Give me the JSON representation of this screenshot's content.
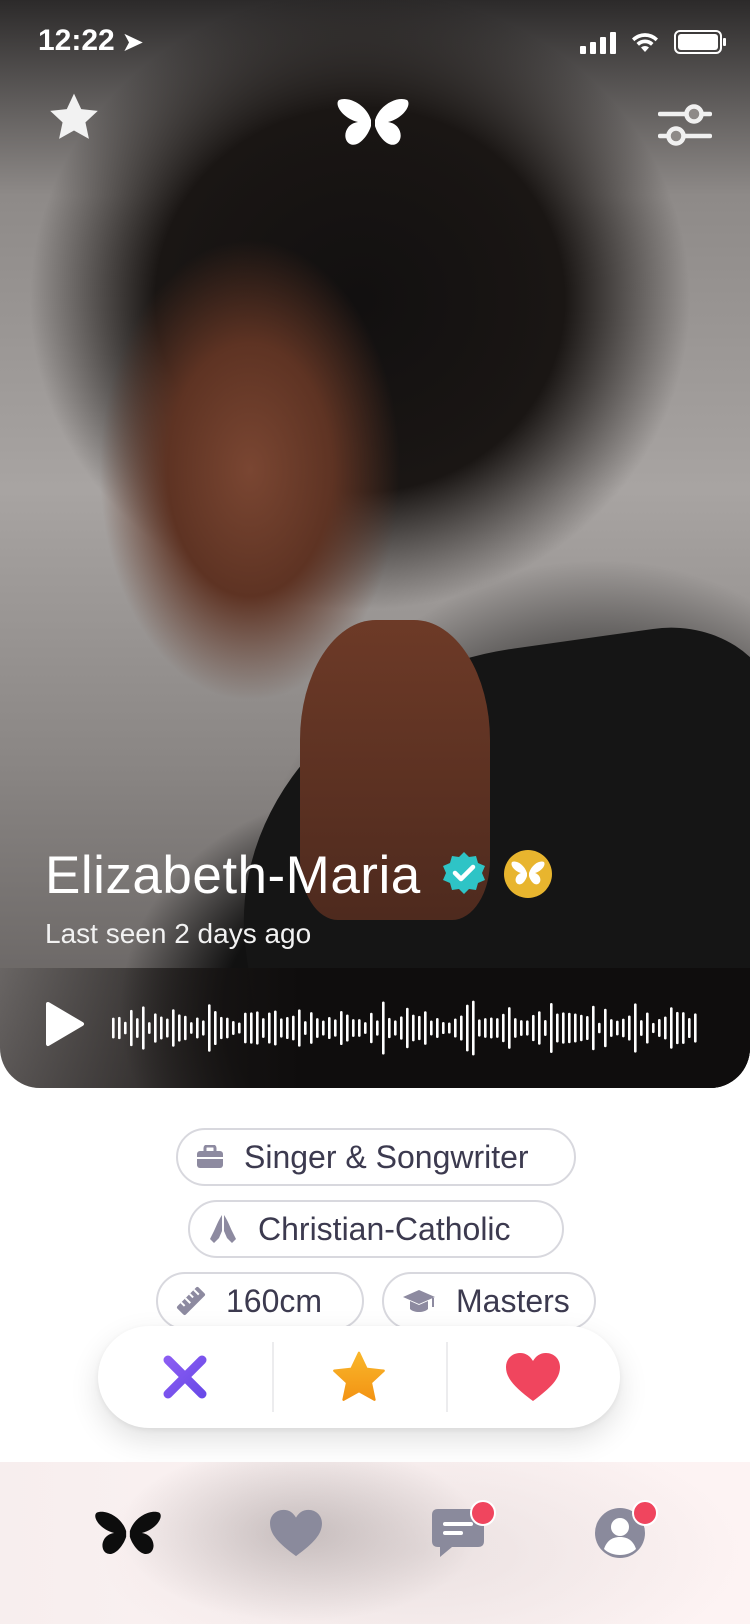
{
  "status_bar": {
    "time": "12:22",
    "location_icon": "location-arrow-icon",
    "signal_icon": "cellular-signal-icon",
    "wifi_icon": "wifi-icon",
    "battery_icon": "battery-icon"
  },
  "header": {
    "left_icon": "star-icon",
    "logo_icon": "butterfly-logo-icon",
    "right_icon": "filter-sliders-icon"
  },
  "profile": {
    "name": "Elizabeth-Maria",
    "last_seen": "Last seen 2 days ago",
    "verified_badge_icon": "verified-check-badge-icon",
    "premium_badge_icon": "butterfly-gold-badge-icon",
    "verified_color": "#2ec4c6",
    "premium_color": "#e8b52e"
  },
  "audio": {
    "play_icon": "play-icon",
    "waveform_icon": "voice-waveform-icon"
  },
  "chips": [
    {
      "icon": "briefcase-icon",
      "label": "Singer & Songwriter"
    },
    {
      "icon": "praying-hands-icon",
      "label": "Christian-Catholic"
    },
    {
      "icon": "ruler-icon",
      "label": "160cm"
    },
    {
      "icon": "graduation-cap-icon",
      "label": "Masters"
    }
  ],
  "actions": {
    "dislike_icon": "x-icon",
    "superlike_icon": "star-icon",
    "like_icon": "heart-icon",
    "dislike_color": "#7a5cf0",
    "superlike_color": "#f6a31d",
    "like_color": "#f0455e"
  },
  "tab_bar": {
    "tabs": [
      {
        "icon": "butterfly-icon",
        "active": true
      },
      {
        "icon": "heart-icon",
        "active": false
      },
      {
        "icon": "chat-bubble-icon",
        "active": false,
        "has_notification": true
      },
      {
        "icon": "profile-icon",
        "active": false,
        "has_notification": true
      }
    ],
    "active_color": "#0d0d0d",
    "inactive_color": "#8a8a9c",
    "notification_color": "#f0455e"
  }
}
